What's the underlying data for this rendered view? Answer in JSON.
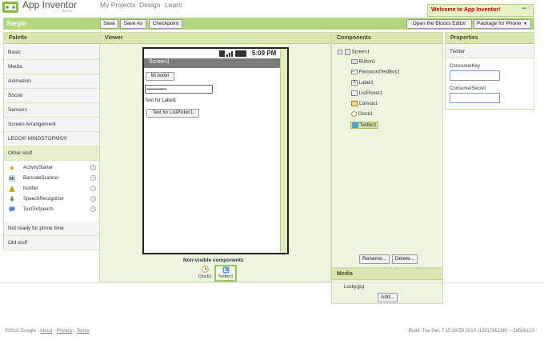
{
  "app": {
    "title": "App Inventor",
    "beta": "BETA",
    "nav": [
      "My Projects",
      "Design",
      "Learn"
    ],
    "welcome": "Welcome to App Inventor!"
  },
  "toolbar": {
    "project_name": "Sergio",
    "save": "Save",
    "save_as": "Save As",
    "checkpoint": "Checkpoint",
    "open_blocks": "Open the Blocks Editor",
    "package": "Package for Phone"
  },
  "palette": {
    "title": "Palette",
    "categories": [
      "Basic",
      "Media",
      "Animation",
      "Social",
      "Sensors",
      "Screen Arrangement",
      "LEGO® MINDSTORMS®"
    ],
    "other_title": "Other stuff",
    "other_items": [
      "ActivityStarter",
      "BarcodeScanner",
      "Notifier",
      "SpeechRecognizer",
      "TextToSpeech"
    ],
    "after": [
      "Not ready for prime time",
      "Old stuff"
    ]
  },
  "viewer": {
    "title": "Viewer",
    "time": "5:09 PM",
    "screen_title": "Screen1",
    "button_text": "Mi botón",
    "password_value": "••••••••••••••••••••",
    "label_text": "Text for Label1",
    "listpicker_text": "Text for ListPicker1",
    "nonvisible_title": "Non-visible components",
    "nonvisible": [
      "Clock1",
      "Twitter1"
    ]
  },
  "components": {
    "title": "Components",
    "root": "Screen1",
    "children": [
      "Button1",
      "PasswordTextBox1",
      "Label1",
      "ListPicker1",
      "Canvas1",
      "Clock1",
      "Twitter1"
    ],
    "rename": "Rename...",
    "delete": "Delete..."
  },
  "media": {
    "title": "Media",
    "files": [
      "Lucky.jpg"
    ],
    "add": "Add..."
  },
  "properties": {
    "title": "Properties",
    "component": "Twitter",
    "fields": [
      {
        "label": "ConsumerKey",
        "value": ""
      },
      {
        "label": "ConsumerSecret",
        "value": ""
      }
    ]
  },
  "footer": {
    "copyright": "©2010 Google -",
    "links": [
      "About",
      "Privacy",
      "Terms"
    ],
    "build": "Build: Tue Dec 7 15:39:56 2010 (1291765196) -- 18508103"
  },
  "colors": {
    "accent_green": "#b4d67c",
    "header_green": "#d7e8b0",
    "panel_bg": "#eef4e0",
    "welcome_red": "#cc0000"
  }
}
